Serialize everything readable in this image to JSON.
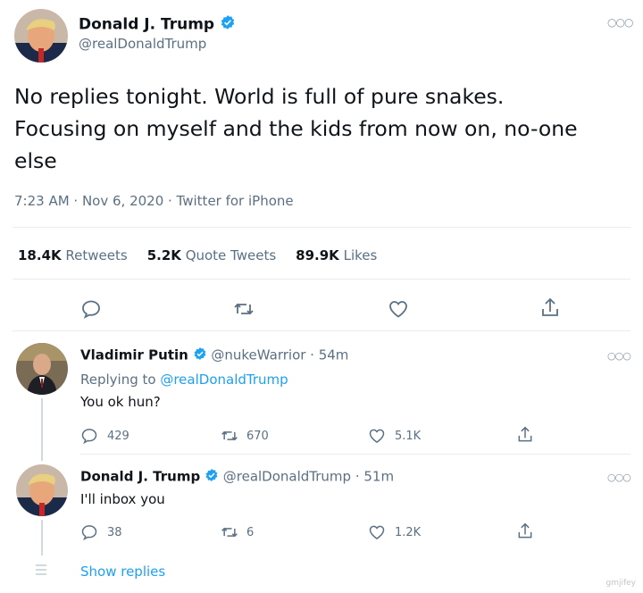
{
  "main_tweet": {
    "name": "Donald J. Trump",
    "handle": "@realDonaldTrump",
    "text_line1": "No replies tonight. World is full of pure snakes.",
    "text_line2": "Focusing on myself and the kids from now on, no-one",
    "text_line3": "else",
    "timestamp": "7:23 AM · Nov 6, 2020 · Twitter for iPhone",
    "stats": {
      "retweets_count": "18.4K",
      "retweets_label": "Retweets",
      "quotes_count": "5.2K",
      "quotes_label": "Quote Tweets",
      "likes_count": "89.9K",
      "likes_label": "Likes"
    }
  },
  "reply1": {
    "name": "Vladimir Putin",
    "handle_time": "@nukeWarrior · 54m",
    "replying_prefix": "Replying to ",
    "replying_handle": "@realDonaldTrump",
    "text": "You ok hun?",
    "replies": "429",
    "retweets": "670",
    "likes": "5.1K"
  },
  "reply2": {
    "name": "Donald J. Trump",
    "handle_time": "@realDonaldTrump · 51m",
    "text": "I'll inbox you",
    "replies": "38",
    "retweets": "6",
    "likes": "1.2K"
  },
  "show_replies": "Show replies",
  "watermark": "gmjifey",
  "colors": {
    "accent": "#1da1f2",
    "text": "#0f1419",
    "muted": "#5b7083",
    "divider": "#e6ecf0"
  },
  "icons": [
    "verified-badge-icon",
    "more-options-icon",
    "reply-icon",
    "retweet-icon",
    "like-icon",
    "share-icon"
  ]
}
